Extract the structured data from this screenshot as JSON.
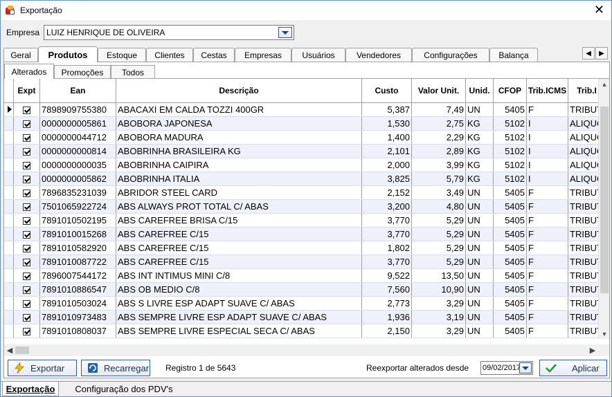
{
  "window": {
    "title": "Exportação",
    "close_glyph": "✕"
  },
  "empresa": {
    "label": "Empresa",
    "value": "LUIZ HENRIQUE DE OLIVEIRA"
  },
  "main_tabs": [
    "Geral",
    "Produtos",
    "Estoque",
    "Clientes",
    "Cestas",
    "Empresas",
    "Usuários",
    "Vendedores",
    "Configurações",
    "Balança"
  ],
  "active_main_tab": "Produtos",
  "sub_tabs": [
    "Alterados",
    "Promoções",
    "Todos"
  ],
  "active_sub_tab": "Alterados",
  "grid": {
    "columns": [
      "Expt",
      "Ean",
      "Descrição",
      "Custo",
      "Valor Unit.",
      "Unid.",
      "CFOP",
      "Trib.ICMS",
      "Trib.I"
    ],
    "rows": [
      [
        "7898909755380",
        "ABACAXI EM CALDA TOZZI 400GR",
        "5,387",
        "7,49",
        "UN",
        "5405",
        "F",
        "TRIBUT"
      ],
      [
        "0000000005861",
        "ABOBORA JAPONESA",
        "1,530",
        "2,75",
        "KG",
        "5102",
        "I",
        "ALIQUO"
      ],
      [
        "0000000044712",
        "ABOBORA MADURA",
        "1,400",
        "2,29",
        "KG",
        "5102",
        "I",
        "ALIQUO"
      ],
      [
        "0000000000814",
        "ABOBRINHA BRASILEIRA KG",
        "2,101",
        "2,89",
        "KG",
        "5102",
        "I",
        "ALIQUO"
      ],
      [
        "0000000000035",
        "ABOBRINHA CAIPIRA",
        "2,000",
        "3,99",
        "KG",
        "5102",
        "I",
        "ALIQUO"
      ],
      [
        "0000000005862",
        "ABOBRINHA ITALIA",
        "3,825",
        "5,79",
        "KG",
        "5102",
        "I",
        "ALIQUO"
      ],
      [
        "7896835231039",
        "ABRIDOR STEEL CARD",
        "2,152",
        "3,49",
        "UN",
        "5405",
        "F",
        "TRIBUT"
      ],
      [
        "7501065922724",
        "ABS ALWAYS PROT TOTAL C/ ABAS",
        "3,200",
        "4,80",
        "UN",
        "5405",
        "F",
        "TRIBUT"
      ],
      [
        "7891010502195",
        "ABS CAREFREE BRISA C/15",
        "3,770",
        "5,29",
        "UN",
        "5405",
        "F",
        "TRIBUT"
      ],
      [
        "7891010015268",
        "ABS CAREFREE C/15",
        "3,770",
        "5,29",
        "UN",
        "5405",
        "F",
        "TRIBUT"
      ],
      [
        "7891010582920",
        "ABS CAREFREE C/15",
        "1,802",
        "5,29",
        "UN",
        "5405",
        "F",
        "TRIBUT"
      ],
      [
        "7891010087722",
        "ABS CAREFREE C/15",
        "3,770",
        "5,29",
        "UN",
        "5405",
        "F",
        "TRIBUT"
      ],
      [
        "7896007544172",
        "ABS INT INTIMUS MINI C/8",
        "9,522",
        "13,50",
        "UN",
        "5405",
        "F",
        "TRIBUT"
      ],
      [
        "7891010886547",
        "ABS OB MEDIO C/8",
        "7,560",
        "10,90",
        "UN",
        "5405",
        "F",
        "TRIBUT"
      ],
      [
        "7891010503024",
        "ABS S LIVRE ESP ADAPT SUAVE C/ ABAS",
        "2,773",
        "3,29",
        "UN",
        "5405",
        "F",
        "TRIBUT"
      ],
      [
        "7891010973483",
        "ABS SEMPRE LIVRE ESP ADAPT SUAVE C/ ABAS",
        "1,936",
        "3,19",
        "UN",
        "5405",
        "F",
        "TRIBUT"
      ],
      [
        "7891010808037",
        "ABS SEMPRE LIVRE ESPECIAL SECA C/ ABAS",
        "2,150",
        "3,29",
        "UN",
        "5405",
        "F",
        "TRIBUT"
      ]
    ]
  },
  "bottom": {
    "exportar_label": "Exportar",
    "recarregar_label": "Recarregar",
    "registro_text": "Registro 1 de 5643",
    "reexportar_label": "Reexportar alterados desde",
    "date_value": "09/02/2017",
    "aplicar_label": "Aplicar"
  },
  "bottom_tabs": [
    "Exportação",
    "Configuração dos PDV's"
  ],
  "colors": {
    "accent": "#2b5aa8",
    "row_alt": "#eef1fa",
    "check_green": "#1e9e2f",
    "lightning": "#f2b705"
  }
}
